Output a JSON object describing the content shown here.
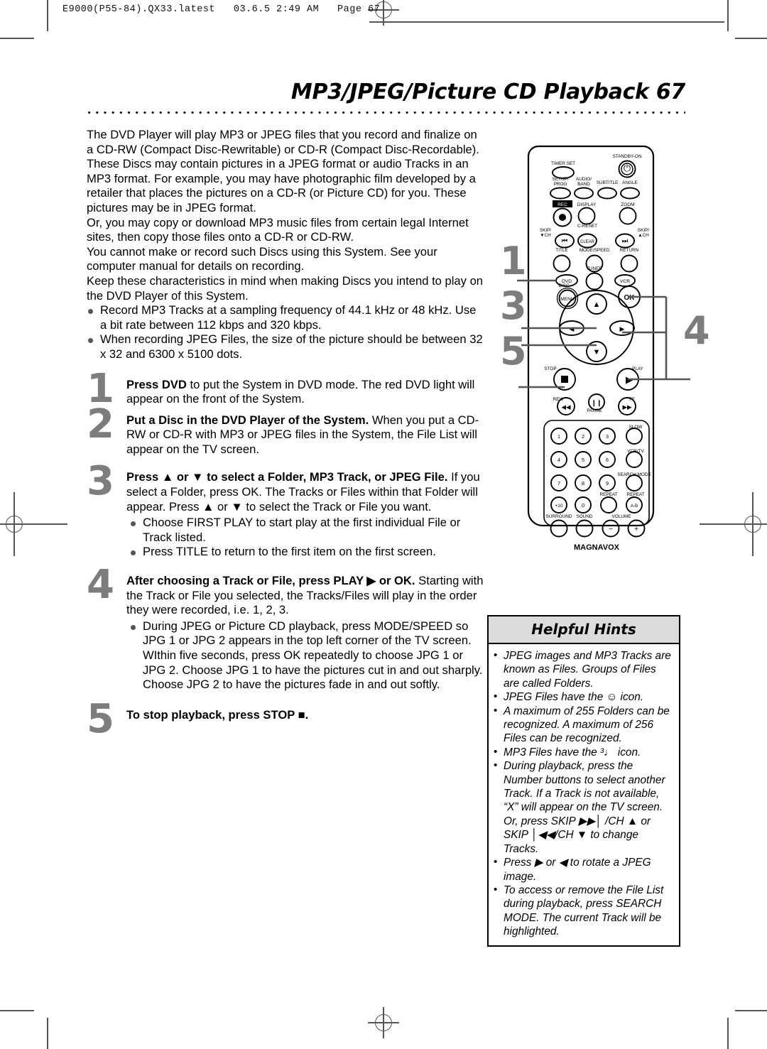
{
  "printer_header": "E9000(P55-84).QX33.latest   03.6.5 2:49 AM   Page 67",
  "page": {
    "title": "MP3/JPEG/Picture CD Playback  67",
    "number": "67"
  },
  "intro": {
    "p1": "The DVD Player will play MP3 or JPEG files that you record and finalize on a CD-RW (Compact Disc-Rewritable) or CD-R (Compact Disc-Recordable).",
    "p2": "These Discs may contain pictures in a JPEG format or audio Tracks in an MP3 format. For example, you may have photographic film developed by a retailer that places the pictures on a CD-R (or Picture CD) for you.  These pictures may be in JPEG format.",
    "p3": "Or, you may copy or download MP3 music files from certain legal Internet sites, then copy those files onto a CD-R or CD-RW.",
    "p4": "You cannot make or record such Discs using this System. See your computer manual for details on recording.",
    "p5": "Keep these characteristics in mind when making Discs you intend to play on the DVD Player of this System.",
    "bullets": [
      "Record MP3 Tracks at a sampling frequency of 44.1 kHz or 48 kHz. Use a bit rate between 112 kbps and 320 kbps.",
      "When recording JPEG Files, the size of the picture should be between 32 x 32 and 6300 x 5100 dots."
    ]
  },
  "steps": [
    {
      "num": "1",
      "bold": "Press DVD",
      "rest": " to put the System in DVD mode. The red DVD light will appear on the front of the System.",
      "bullets": []
    },
    {
      "num": "2",
      "bold": "Put a Disc in the DVD Player of the System.",
      "rest": " When you put a CD-RW or CD-R with MP3 or JPEG files in the System, the File List will appear on the TV screen.",
      "bullets": []
    },
    {
      "num": "3",
      "bold": "Press ▲ or ▼ to select a Folder, MP3 Track, or JPEG File.",
      "rest": " If you select a Folder, press OK.  The Tracks or Files within that Folder will appear.  Press ▲ or ▼ to select the Track or File you want.",
      "bullets": [
        "Choose FIRST PLAY to start play at the first individual File or Track listed.",
        "Press TITLE to return to the first item on the first screen."
      ]
    },
    {
      "num": "4",
      "bold": "After choosing a Track or File, press PLAY ▶ or OK.",
      "rest": " Starting with the Track or File you selected, the Tracks/Files will play in the order they were recorded, i.e. 1, 2, 3.",
      "bullets": [
        "During JPEG or Picture CD playback, press MODE/SPEED so JPG 1 or JPG 2 appears in the top left corner of the TV screen. WIthin five seconds, press OK repeatedly to choose JPG 1 or JPG 2. Choose JPG 1 to have the pictures cut in and out sharply. Choose JPG 2 to have the pictures fade in and out softly."
      ]
    },
    {
      "num": "5",
      "bold": "To stop playback, press STOP ■.",
      "rest": "",
      "bullets": []
    }
  ],
  "hints": {
    "title": "Helpful Hints",
    "items": [
      "JPEG images and MP3 Tracks are known as Files. Groups of Files are called Folders.",
      "JPEG Files have the ☺ icon.",
      "A maximum of 255 Folders can be recognized. A maximum of 256 Files can be recognized.",
      "MP3 Files have the ³♩ icon.",
      "During playback, press the Number buttons to select another Track. If a Track is not available, “X” will appear on the TV screen. Or, press SKIP ▶▶│ /CH ▲ or SKIP │◀◀/CH ▼ to change Tracks.",
      "Press ▶ or ◀ to rotate a JPEG image.",
      "To access or remove the File List during playback, press SEARCH MODE. The current Track will be highlighted."
    ]
  },
  "remote": {
    "brand": "MAGNAVOX",
    "callouts": [
      "1",
      "3",
      "5",
      "4"
    ],
    "buttons": {
      "timer_set": "TIMER SET",
      "standby_on": "STANDBY-ON",
      "setup_prog": "SETUP/\nPROG",
      "audio_band": "AUDIO/\nBAND",
      "subtitle": "SUBTITLE",
      "angle": "ANGLE",
      "rec": "REC",
      "display": "DISPLAY",
      "zoom": "ZOOM",
      "skip_down": "SKIP/\n▼CH",
      "c_reset": "C-RESET",
      "clear": "CLEAR",
      "skip_up": "SKIP/\n▲CH",
      "title": "TITLE",
      "mode_speed": "MODE/SPEED",
      "return": "RETURN",
      "dvd": "DVD",
      "tuner": "TUNER",
      "vcr": "VCR",
      "disc": "DISC",
      "menu": "MENU",
      "ok": "OK",
      "stop": "STOP",
      "play": "PLAY",
      "rew": "REW",
      "pause": "PAUSE",
      "ff": "FF",
      "slow": "SLOW",
      "vcr_tv": "VCR/TV",
      "search_mode": "SEARCH MODE",
      "repeat": "REPEAT",
      "repeat_ab": "REPEAT",
      "repeat_ab_val": "A-B",
      "surround": "SURROUND",
      "sound": "SOUND",
      "volume": "VOLUME",
      "vol_minus": "−",
      "vol_plus": "+"
    },
    "numbers": [
      "1",
      "2",
      "3",
      "4",
      "5",
      "6",
      "7",
      "8",
      "9",
      "+10",
      "0"
    ]
  }
}
